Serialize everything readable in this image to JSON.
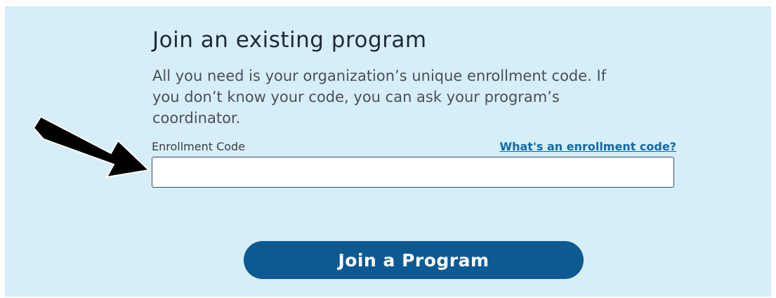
{
  "form": {
    "title": "Join an existing program",
    "description": "All you need is your organization’s unique enrollment code. If you don’t know your code, you can ask your program’s coordinator.",
    "enrollment_code_label": "Enrollment Code",
    "enrollment_code_value": "",
    "help_link": "What's an enrollment code?",
    "submit_label": "Join a Program"
  },
  "annotation": {
    "arrow_icon": "arrow-pointing-right-down",
    "arrow_color": "#000000"
  },
  "colors": {
    "panel_background": "#d6eef8",
    "button_background": "#0d5a93",
    "link": "#0f6aa8",
    "input_border": "#2b4f70"
  }
}
